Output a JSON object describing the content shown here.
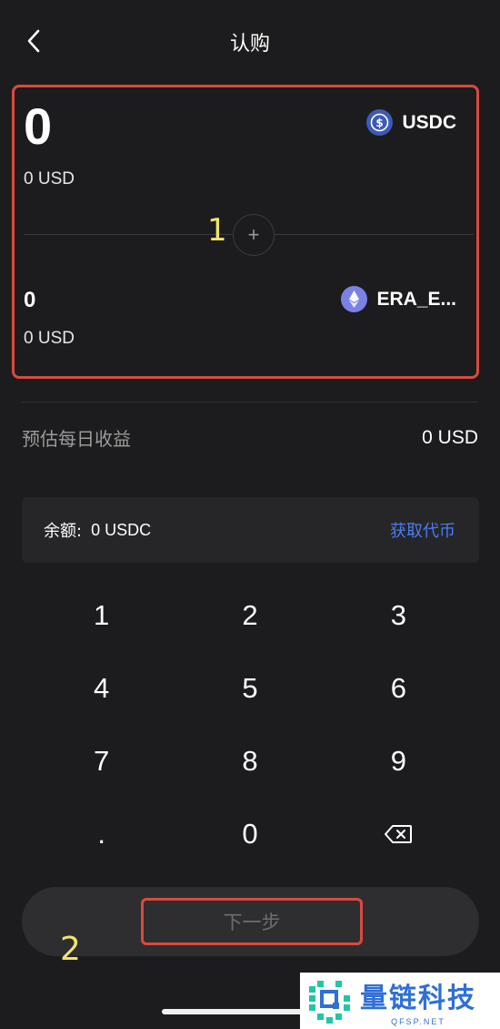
{
  "header": {
    "title": "认购"
  },
  "swap": {
    "from": {
      "amount": "0",
      "usd": "0 USD",
      "token": "USDC",
      "icon": "usdc-icon"
    },
    "to": {
      "amount": "0",
      "usd": "0 USD",
      "token": "ERA_E...",
      "icon": "eth-icon"
    },
    "plus": "+"
  },
  "annotations": {
    "one": "1",
    "two": "2"
  },
  "estimate": {
    "label": "预估每日收益",
    "value": "0 USD"
  },
  "balance": {
    "label": "余额:",
    "value": "0 USDC",
    "action": "获取代币"
  },
  "keypad": {
    "keys": [
      "1",
      "2",
      "3",
      "4",
      "5",
      "6",
      "7",
      "8",
      "9",
      ".",
      "0"
    ]
  },
  "next_button": {
    "label": "下一步"
  },
  "watermark": {
    "name": "量链科技",
    "sub": "QFSP.NET"
  },
  "colors": {
    "highlight_border": "#d94a3f",
    "link_blue": "#4a7cf0",
    "annotation_yellow": "#f2e36a"
  }
}
